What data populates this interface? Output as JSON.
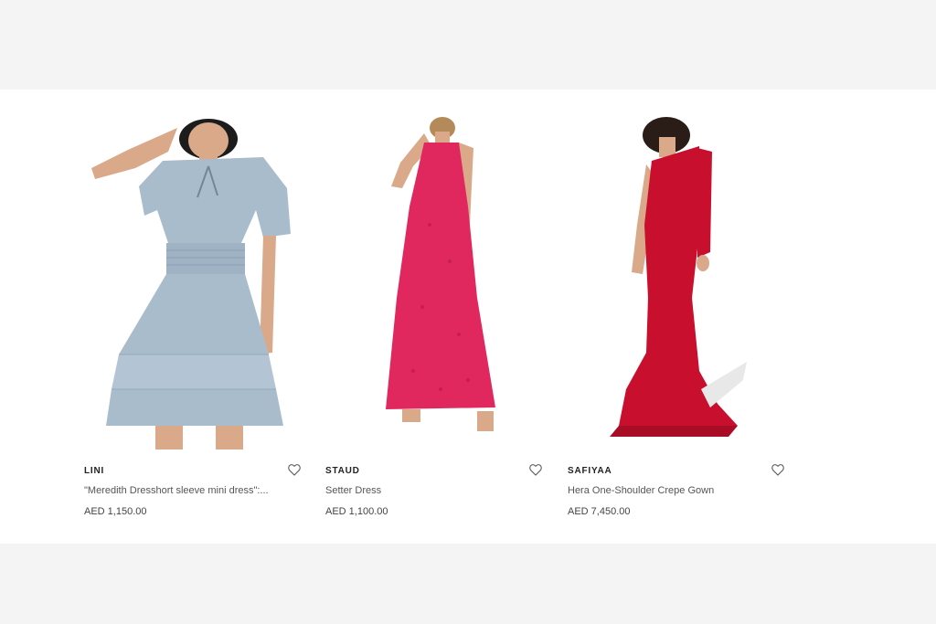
{
  "products": [
    {
      "brand": "LINI",
      "title": "\"Meredith Dresshort sleeve mini dress\":...",
      "price": "AED 1,150.00",
      "image_icon": "blue-mini-dress-image",
      "dress_color": "#a9bccc"
    },
    {
      "brand": "STAUD",
      "title": "Setter Dress",
      "price": "AED 1,100.00",
      "image_icon": "pink-maxi-dress-image",
      "dress_color": "#e0285f"
    },
    {
      "brand": "SAFIYAA",
      "title": "Hera One-Shoulder Crepe Gown",
      "price": "AED 7,450.00",
      "image_icon": "red-gown-image",
      "dress_color": "#c8102e"
    }
  ],
  "colors": {
    "page_background": "#f4f4f4",
    "band_background": "#ffffff",
    "skin": "#d9a98a"
  },
  "icons": {
    "wishlist": "heart-icon"
  }
}
